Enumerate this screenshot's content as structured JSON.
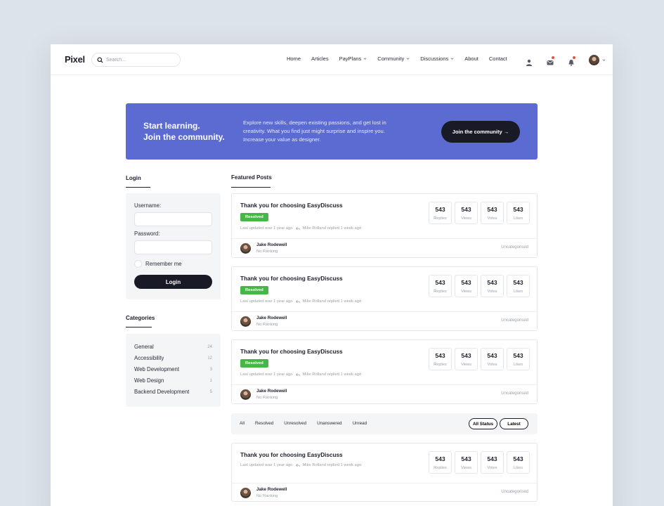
{
  "header": {
    "logo": "Pixel",
    "search_placeholder": "Search...",
    "nav": [
      {
        "label": "Home",
        "dropdown": false
      },
      {
        "label": "Articles",
        "dropdown": false
      },
      {
        "label": "PayPlans",
        "dropdown": true
      },
      {
        "label": "Community",
        "dropdown": true
      },
      {
        "label": "Discussions",
        "dropdown": true
      },
      {
        "label": "About",
        "dropdown": false
      },
      {
        "label": "Contact",
        "dropdown": false
      }
    ]
  },
  "hero": {
    "title_line1": "Start learning.",
    "title_line2": "Join the community.",
    "text": "Explore new skills, deepen existing passions, and get lost in creativity. What you find just might surprise and inspire you. Increase your value as designer.",
    "button": "Join the community →"
  },
  "login": {
    "title": "Login",
    "username_label": "Username:",
    "password_label": "Password:",
    "remember_label": "Remember me",
    "button": "Login"
  },
  "categories": {
    "title": "Categories",
    "items": [
      {
        "name": "General",
        "count": "24"
      },
      {
        "name": "Accessibility",
        "count": "12"
      },
      {
        "name": "Web Development",
        "count": "3"
      },
      {
        "name": "Web Design",
        "count": "1"
      },
      {
        "name": "Backend Development",
        "count": "5"
      }
    ]
  },
  "featured": {
    "title": "Featured Posts"
  },
  "posts": [
    {
      "title": "Thank you for choosing EasyDiscuss",
      "badge": "Resolved",
      "meta_updated": "Last updated was 1 year ago",
      "meta_reply": "Mike Rolland replied 1 week ago",
      "stats": [
        {
          "num": "543",
          "label": "Replies"
        },
        {
          "num": "543",
          "label": "Views"
        },
        {
          "num": "543",
          "label": "Votes"
        },
        {
          "num": "543",
          "label": "Likes"
        }
      ],
      "author": "Jake Rodewell",
      "rank": "No Ranking",
      "category": "Uncategorised"
    },
    {
      "title": "Thank you for choosing EasyDiscuss",
      "badge": "Resolved",
      "meta_updated": "Last updated was 1 year ago",
      "meta_reply": "Mike Rolland replied 1 week ago",
      "stats": [
        {
          "num": "543",
          "label": "Replies"
        },
        {
          "num": "543",
          "label": "Views"
        },
        {
          "num": "543",
          "label": "Votes"
        },
        {
          "num": "543",
          "label": "Likes"
        }
      ],
      "author": "Jake Rodewell",
      "rank": "No Ranking",
      "category": "Uncategorised"
    },
    {
      "title": "Thank you for choosing EasyDiscuss",
      "badge": "Resolved",
      "meta_updated": "Last updated was 1 year ago",
      "meta_reply": "Mike Rolland replied 1 week ago",
      "stats": [
        {
          "num": "543",
          "label": "Replies"
        },
        {
          "num": "543",
          "label": "Views"
        },
        {
          "num": "543",
          "label": "Votes"
        },
        {
          "num": "543",
          "label": "Likes"
        }
      ],
      "author": "Jake Rodewell",
      "rank": "No Ranking",
      "category": "Uncategorised"
    },
    {
      "title": "Thank you for choosing EasyDiscuss",
      "meta_updated": "Last updated was 1 year ago",
      "meta_reply": "Mike Rolland replied 1 week ago",
      "stats": [
        {
          "num": "543",
          "label": "Replies"
        },
        {
          "num": "543",
          "label": "Views"
        },
        {
          "num": "543",
          "label": "Votes"
        },
        {
          "num": "543",
          "label": "Likes"
        }
      ],
      "author": "Jake Rodewell",
      "rank": "No Ranking",
      "category": "Uncategorised"
    }
  ],
  "filters": {
    "tabs": [
      "All",
      "Resolved",
      "Unresolved",
      "Unanswered",
      "Unread"
    ],
    "status_button": "All Status",
    "sort_button": "Latest"
  },
  "colors": {
    "hero_bg": "#5b6bd2",
    "dark": "#181a26",
    "resolved": "#46b648",
    "notification": "#e2553b"
  },
  "icons": {
    "search": "search-icon",
    "user": "user-icon",
    "mail": "mail-icon",
    "bell": "bell-icon",
    "reply": "reply-icon",
    "chevron": "chevron-down-icon"
  }
}
